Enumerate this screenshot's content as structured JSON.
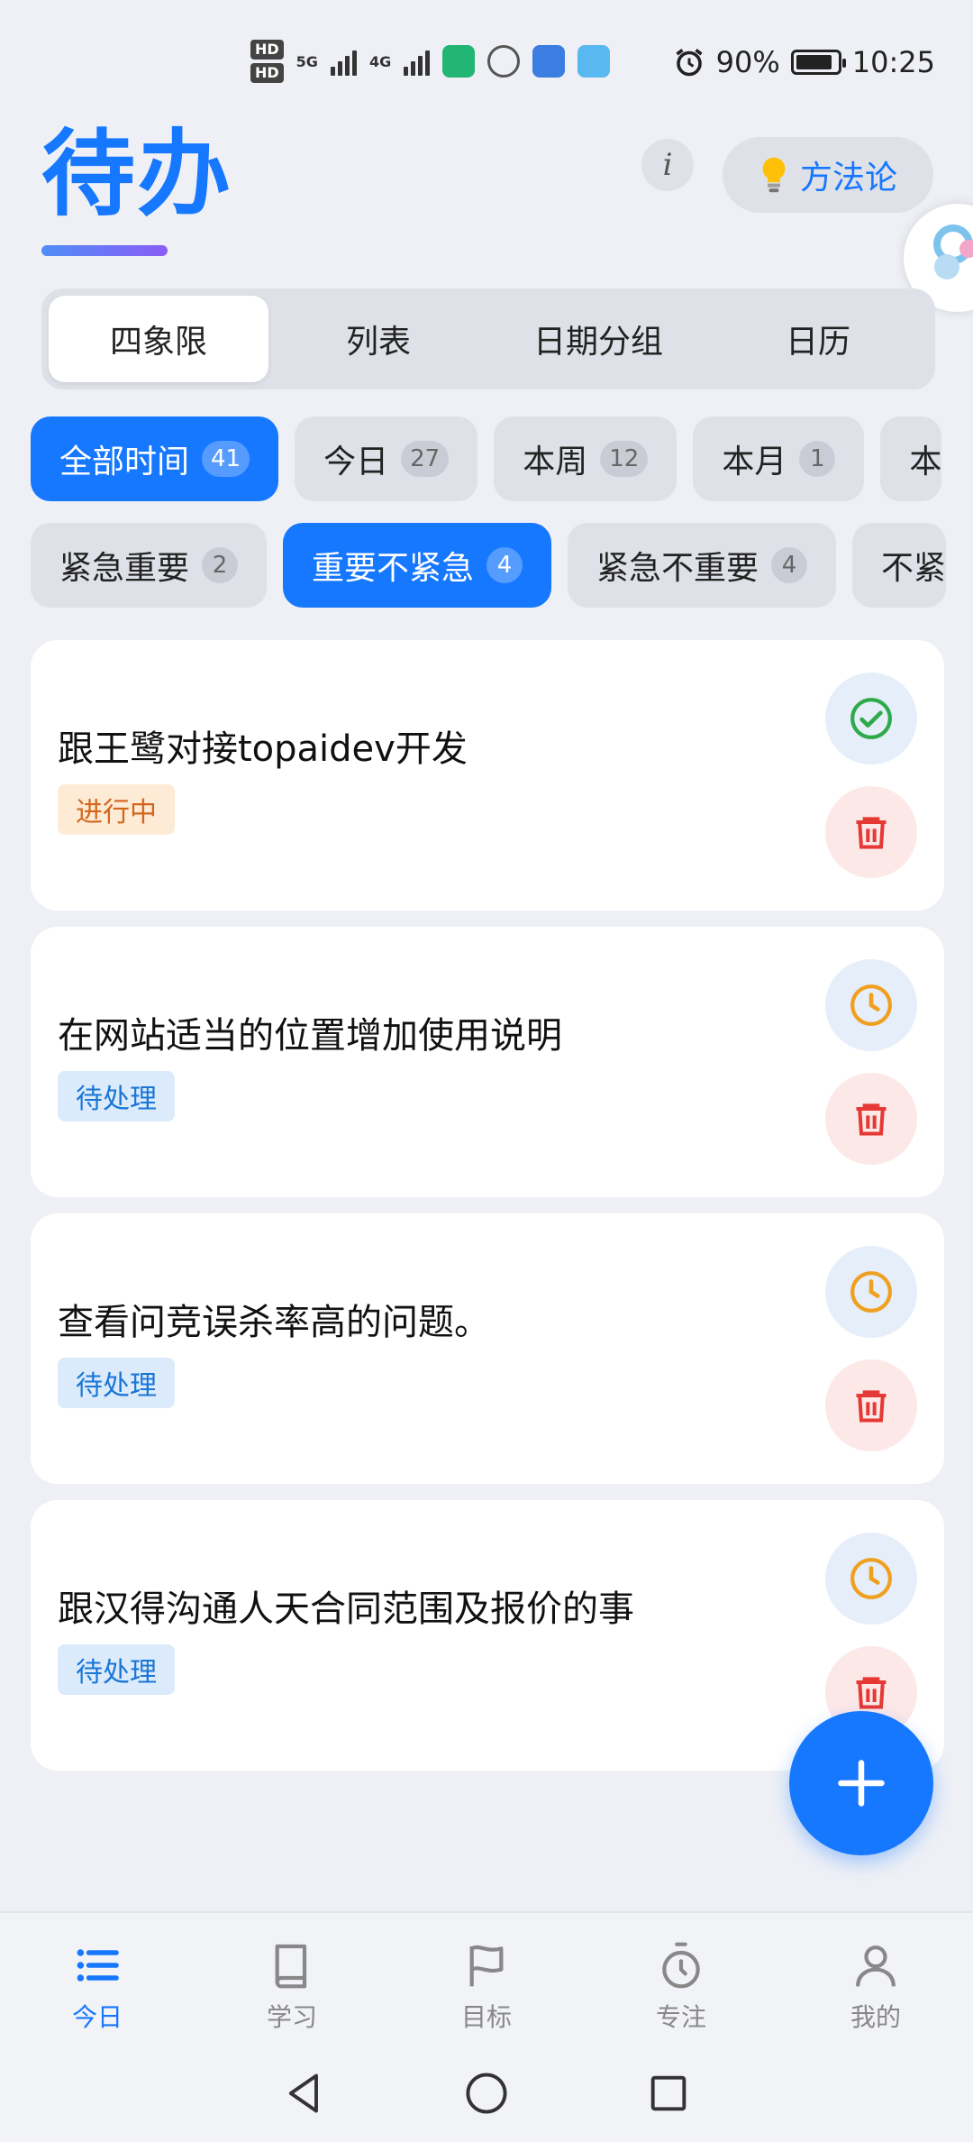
{
  "status_bar": {
    "hd1": "HD",
    "hd2": "HD",
    "net1": "5G",
    "net2": "4G",
    "battery": "90%",
    "time": "10:25"
  },
  "header": {
    "title": "待办",
    "info_label": "i",
    "method_label": "方法论"
  },
  "view_tabs": [
    "四象限",
    "列表",
    "日期分组",
    "日历"
  ],
  "time_filters": [
    {
      "label": "全部时间",
      "count": "41"
    },
    {
      "label": "今日",
      "count": "27"
    },
    {
      "label": "本周",
      "count": "12"
    },
    {
      "label": "本月",
      "count": "1"
    },
    {
      "label": "本",
      "count": ""
    }
  ],
  "priority_filters": [
    {
      "label": "紧急重要",
      "count": "2"
    },
    {
      "label": "重要不紧急",
      "count": "4"
    },
    {
      "label": "紧急不重要",
      "count": "4"
    },
    {
      "label": "不紧",
      "count": ""
    }
  ],
  "tasks": [
    {
      "title": "跟王鹭对接topaidev开发",
      "status": "进行中"
    },
    {
      "title": "在网站适当的位置增加使用说明",
      "status": "待处理"
    },
    {
      "title": "查看问竞误杀率高的问题。",
      "status": "待处理"
    },
    {
      "title": "跟汉得沟通人天合同范围及报价的事",
      "status": "待处理"
    }
  ],
  "bottom_nav": [
    {
      "label": "今日",
      "icon": "list-icon"
    },
    {
      "label": "学习",
      "icon": "book-icon"
    },
    {
      "label": "目标",
      "icon": "flag-icon"
    },
    {
      "label": "专注",
      "icon": "timer-icon"
    },
    {
      "label": "我的",
      "icon": "user-icon"
    }
  ],
  "colors": {
    "accent": "#1677ff",
    "in_progress": "#d4661a",
    "pending": "#1a76d6",
    "delete": "#e53935",
    "complete": "#2eaa4a",
    "clock": "#f0a020"
  }
}
